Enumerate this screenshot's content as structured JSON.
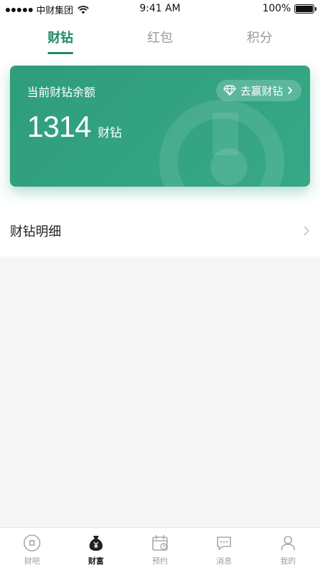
{
  "status_bar": {
    "carrier": "中财集团",
    "time": "9:41 AM",
    "battery": "100%",
    "battery_level": 1.0
  },
  "tabs": [
    {
      "label": "财钻",
      "active": true
    },
    {
      "label": "红包",
      "active": false
    },
    {
      "label": "积分",
      "active": false
    }
  ],
  "card": {
    "label": "当前财钻余额",
    "button_label": "去赢财钻",
    "amount": "1314",
    "unit": "财钻"
  },
  "detail": {
    "label": "财钻明细"
  },
  "tabbar": {
    "items": [
      {
        "label": "财吧",
        "icon": "coin-icon",
        "active": false
      },
      {
        "label": "财富",
        "icon": "money-bag-icon",
        "active": true
      },
      {
        "label": "预约",
        "icon": "calendar-icon",
        "active": false
      },
      {
        "label": "消息",
        "icon": "message-icon",
        "active": false
      },
      {
        "label": "我的",
        "icon": "user-icon",
        "active": false
      }
    ]
  },
  "colors": {
    "accent": "#1f8a67",
    "card": "#33a381"
  }
}
